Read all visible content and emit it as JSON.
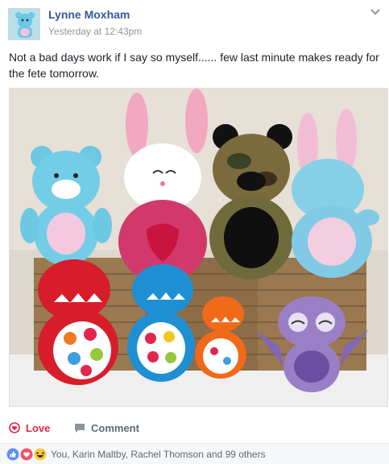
{
  "post": {
    "author": "Lynne Moxham",
    "timestamp": "Yesterday at 12:43pm",
    "text": "Not a bad days work if I say so myself...... few last minute makes ready for the fete tomorrow.",
    "menu_icon": "chevron-down-icon",
    "photo_icon": "photo-of-handmade-soft-toys"
  },
  "actions": {
    "love_label": "Love",
    "love_icon": "heart-outline-icon",
    "comment_label": "Comment",
    "comment_icon": "speech-bubble-icon"
  },
  "reactions": {
    "icons": [
      "like-icon",
      "love-icon",
      "haha-icon"
    ],
    "summary": "You, Karin Maltby, Rachel Thomson and 99 others"
  },
  "colors": {
    "link": "#365899",
    "love": "#e2264d",
    "muted": "#90949c",
    "like": "#5890ff"
  }
}
